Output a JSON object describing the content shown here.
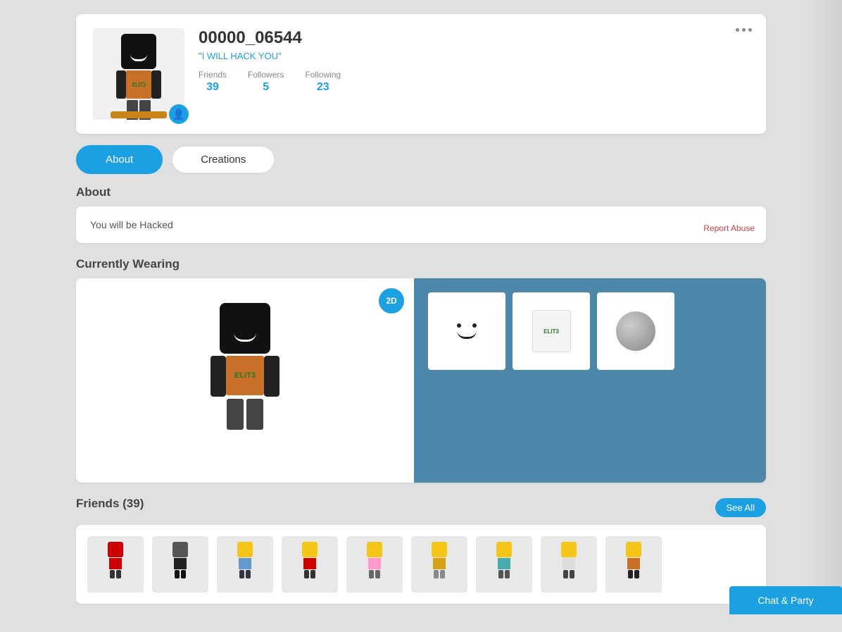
{
  "profile": {
    "username": "00000_06544",
    "status": "\"I WILL HACK YOU\"",
    "friends_label": "Friends",
    "friends_count": "39",
    "followers_label": "Followers",
    "followers_count": "5",
    "following_label": "Following",
    "following_count": "23"
  },
  "tabs": {
    "about_label": "About",
    "creations_label": "Creations"
  },
  "about": {
    "heading": "About",
    "text": "You will be Hacked",
    "report_label": "Report Abuse"
  },
  "wearing": {
    "heading": "Currently Wearing",
    "badge_2d": "2D",
    "item1_label": "Smiley Face",
    "item2_label": "ELIT3 Shirt",
    "item3_label": "Grey Head"
  },
  "friends": {
    "heading": "Friends (39)",
    "see_all_label": "See All"
  },
  "chat_party": {
    "label": "Chat & Party"
  }
}
